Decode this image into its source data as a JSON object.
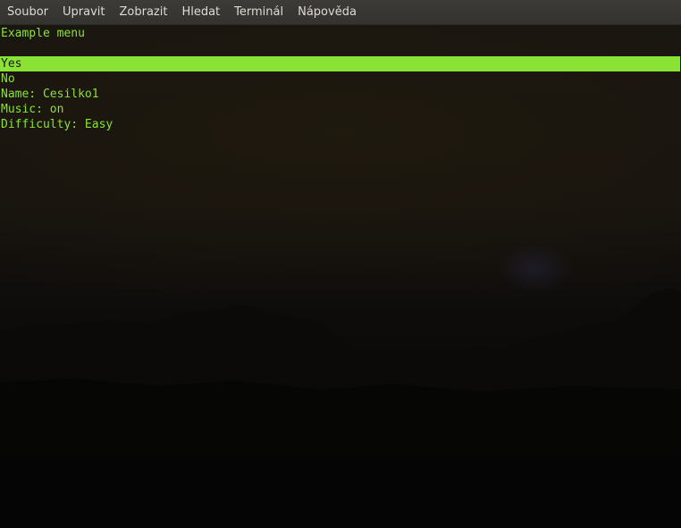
{
  "menubar": {
    "items": [
      "Soubor",
      "Upravit",
      "Zobrazit",
      "Hledat",
      "Terminál",
      "Nápověda"
    ]
  },
  "terminal": {
    "title": "Example menu",
    "options": [
      "Yes",
      "No",
      "Name: Cesilko1",
      "Music: on",
      "Difficulty: Easy"
    ],
    "selected_index": 0,
    "text_color": "#8ae234",
    "selection_color": "#8ae234"
  }
}
